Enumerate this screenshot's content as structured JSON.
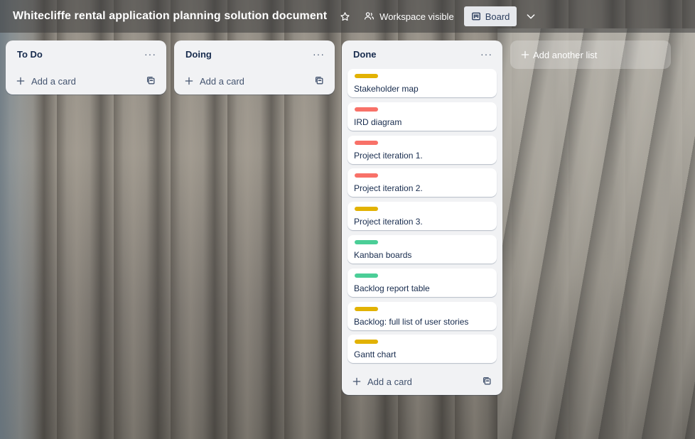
{
  "board": {
    "title": "Whitecliffe rental application planning solution document",
    "visibility_label": "Workspace visible",
    "view_label": "Board",
    "icons": {
      "star": "star-icon",
      "visibility": "people-icon",
      "view": "board-icon",
      "switcher": "chevron-down-icon"
    }
  },
  "lists": [
    {
      "title": "To Do",
      "menu": "···",
      "add_card_label": "Add a card",
      "cards": []
    },
    {
      "title": "Doing",
      "menu": "···",
      "add_card_label": "Add a card",
      "cards": []
    },
    {
      "title": "Done",
      "menu": "···",
      "add_card_label": "Add a card",
      "cards": [
        {
          "title": "Stakeholder map",
          "label_color": "#e2b203"
        },
        {
          "title": "IRD diagram",
          "label_color": "#f87168"
        },
        {
          "title": "Project iteration 1.",
          "label_color": "#f87168"
        },
        {
          "title": "Project iteration 2.",
          "label_color": "#f87168"
        },
        {
          "title": "Project iteration 3.",
          "label_color": "#e2b203"
        },
        {
          "title": "Kanban boards",
          "label_color": "#4bce97"
        },
        {
          "title": "Backlog report table",
          "label_color": "#4bce97"
        },
        {
          "title": "Backlog: full list of user stories",
          "label_color": "#e2b203"
        },
        {
          "title": "Gantt chart",
          "label_color": "#e2b203"
        }
      ]
    }
  ],
  "add_list_label": "Add another list",
  "colors": {
    "list_bg": "#f1f2f4",
    "text": "#172b4d",
    "muted": "#44546f"
  }
}
